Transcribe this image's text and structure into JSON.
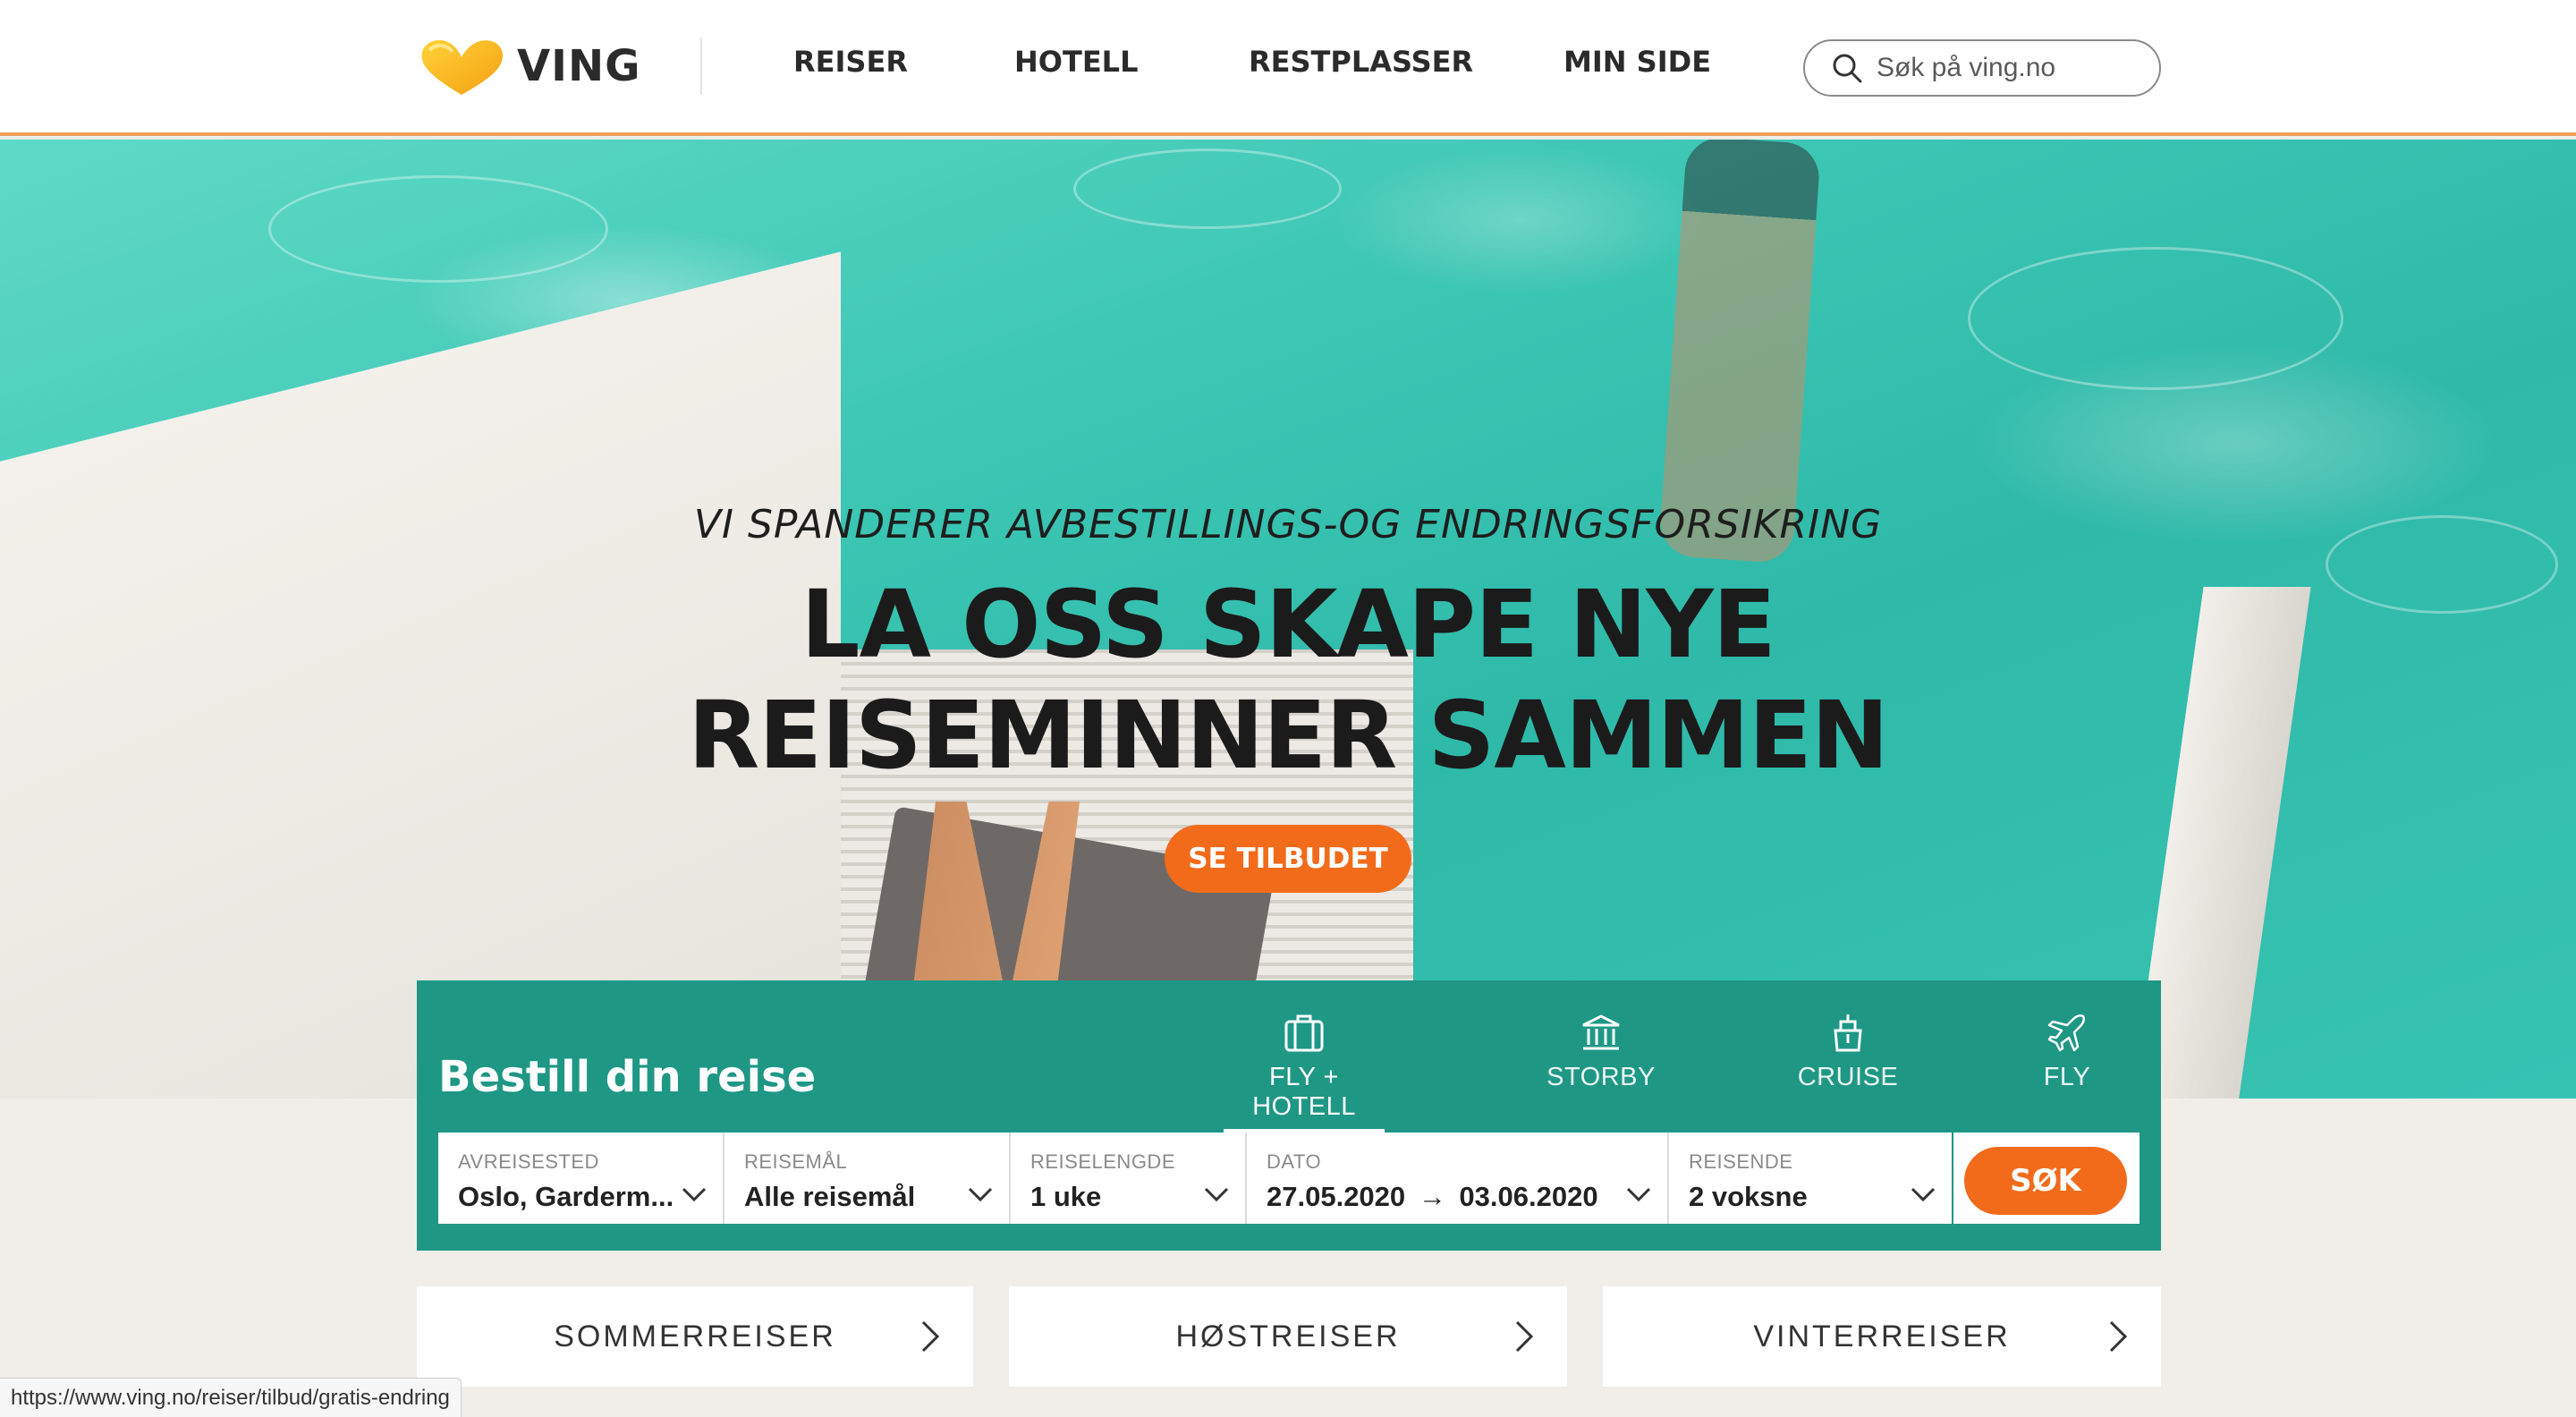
{
  "header": {
    "logo_text": "VING",
    "nav": [
      "REISER",
      "HOTELL",
      "RESTPLASSER",
      "MIN SIDE"
    ],
    "search_placeholder": "Søk på ving.no"
  },
  "hero": {
    "kicker": "VI SPANDERER AVBESTILLINGS-OG ENDRINGSFORSIKRING",
    "title_line1": "LA OSS SKAPE NYE",
    "title_line2": "REISEMINNER SAMMEN",
    "cta": "SE TILBUDET"
  },
  "booking": {
    "title": "Bestill din reise",
    "tabs": [
      {
        "label": "FLY + HOTELL",
        "icon": "suitcase-icon",
        "active": true
      },
      {
        "label": "STORBY",
        "icon": "building-icon",
        "active": false
      },
      {
        "label": "CRUISE",
        "icon": "ship-icon",
        "active": false
      },
      {
        "label": "FLY",
        "icon": "airplane-icon",
        "active": false
      }
    ],
    "fields": {
      "departure": {
        "label": "AVREISESTED",
        "value": "Oslo, Garderm..."
      },
      "destination": {
        "label": "REISEMÅL",
        "value": "Alle reisemål"
      },
      "duration": {
        "label": "REISELENGDE",
        "value": "1 uke"
      },
      "date": {
        "label": "DATO",
        "from": "27.05.2020",
        "arrow": "→",
        "to": "03.06.2020"
      },
      "travelers": {
        "label": "REISENDE",
        "value": "2 voksne"
      }
    },
    "search_button": "SØK"
  },
  "seasons": [
    "SOMMERREISER",
    "HØSTREISER",
    "VINTERREISER"
  ],
  "status_url": "https://www.ving.no/reiser/tilbud/gratis-endring",
  "colors": {
    "accent": "#f26b1b",
    "teal": "#1f9785",
    "header_border": "#f0a05b"
  }
}
